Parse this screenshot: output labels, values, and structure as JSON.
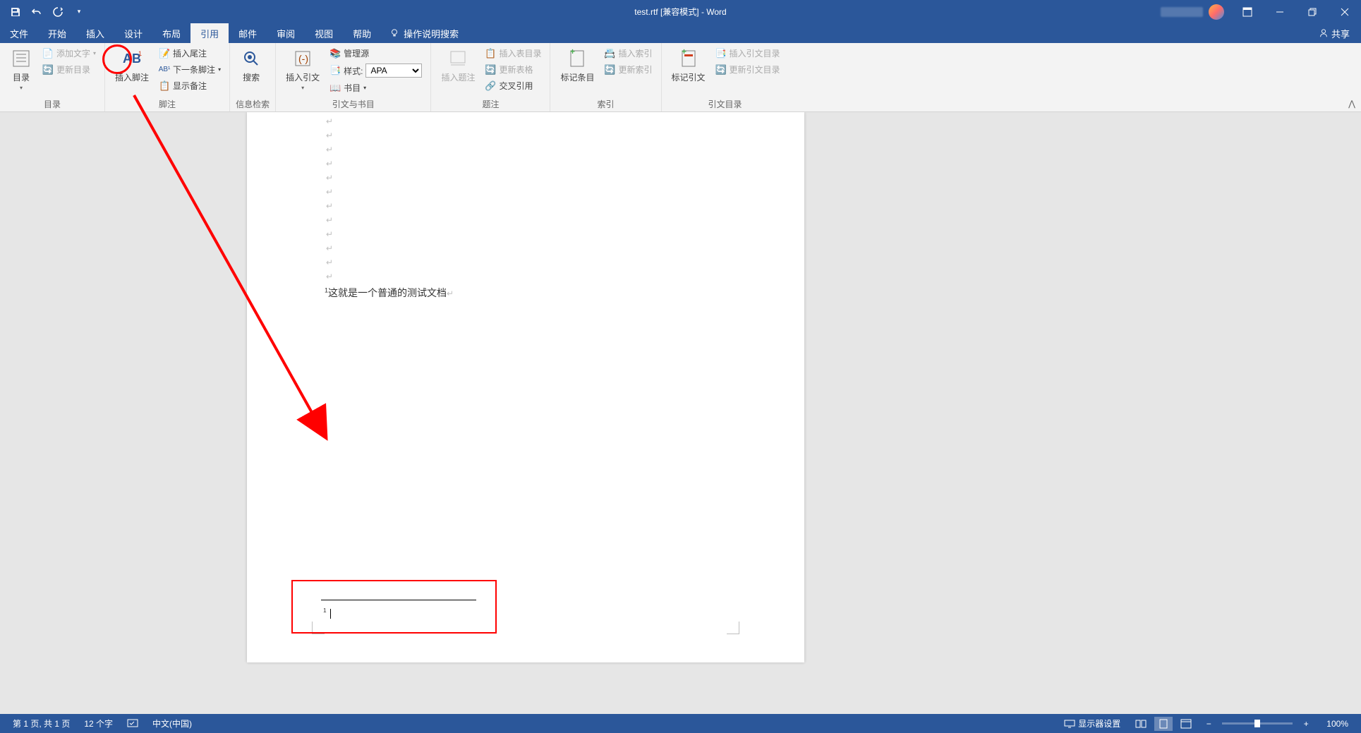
{
  "titlebar": {
    "document_title": "test.rtf [兼容模式] - Word"
  },
  "tabs": {
    "file": "文件",
    "home": "开始",
    "insert": "插入",
    "design": "设计",
    "layout": "布局",
    "references": "引用",
    "mailings": "邮件",
    "review": "审阅",
    "view": "视图",
    "help": "帮助",
    "tell_me": "操作说明搜索",
    "share": "共享"
  },
  "ribbon": {
    "toc_group": "目录",
    "toc_button": "目录",
    "add_text": "添加文字",
    "update_toc": "更新目录",
    "footnote_group": "脚注",
    "insert_footnote": "插入脚注",
    "insert_endnote": "插入尾注",
    "next_footnote": "下一条脚注",
    "show_notes": "显示备注",
    "research_group": "信息检索",
    "search_button": "搜索",
    "citation_group": "引文与书目",
    "insert_citation": "插入引文",
    "manage_sources": "管理源",
    "style_label": "样式:",
    "style_value": "APA",
    "bibliography": "书目",
    "caption_group": "题注",
    "insert_caption": "插入题注",
    "insert_tof": "插入表目录",
    "update_table": "更新表格",
    "cross_reference": "交叉引用",
    "index_group": "索引",
    "mark_entry": "标记条目",
    "insert_index": "插入索引",
    "update_index": "更新索引",
    "toa_group": "引文目录",
    "mark_citation": "标记引文",
    "insert_toa": "插入引文目录",
    "update_toa": "更新引文目录"
  },
  "document": {
    "body_text": "这就是一个普通的测试文档",
    "footnote_ref": "1",
    "footnote_number": "1"
  },
  "statusbar": {
    "page_info": "第 1 页, 共 1 页",
    "word_count": "12 个字",
    "language": "中文(中国)",
    "display_settings": "显示器设置",
    "zoom_value": "100%"
  }
}
